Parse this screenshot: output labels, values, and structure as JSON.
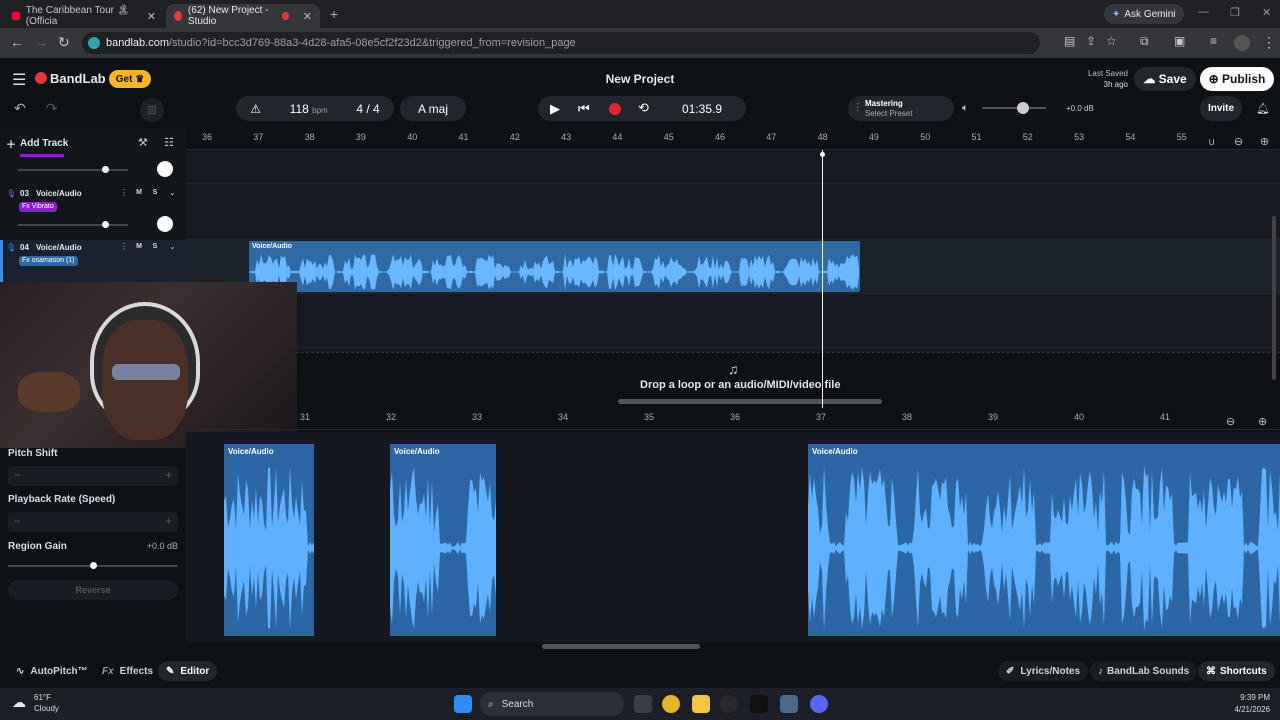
{
  "browser": {
    "tabs": [
      {
        "title": "The Caribbean Tour 🏝 (Officia"
      },
      {
        "title": "(62) New Project - Studio"
      }
    ],
    "url_host": "bandlab.com",
    "url_path": "/studio?id=bcc3d769-88a3-4d28-afa5-08e5cf2f23d2&triggered_from=revision_page",
    "ask_gemini": "Ask Gemini"
  },
  "app": {
    "logo": "BandLab",
    "get_label": "Get",
    "project_title": "New Project",
    "last_saved_label": "Last Saved",
    "last_saved_time": "3h ago",
    "save_label": "Save",
    "publish_label": "Publish",
    "invite_label": "Invite"
  },
  "transport": {
    "bpm": "118",
    "bpm_unit": "bpm",
    "time_sig": "4 / 4",
    "key": "A maj",
    "time": "01:35.9",
    "mastering_label": "Mastering",
    "mastering_preset": "Select Preset",
    "volume": "+0.0 dB"
  },
  "tracks": {
    "add_track": "Add Track",
    "list": [
      {
        "number": "03",
        "name": "Voice/Audio",
        "fx": "Fx  Vibrato",
        "m": "M",
        "s": "S"
      },
      {
        "number": "04",
        "name": "Voice/Audio",
        "fx": "Fx  osamason (1)",
        "m": "M",
        "s": "S"
      }
    ],
    "region_label": "Voice/Audio",
    "drop_text": "Drop a loop or an audio/MIDI/video file"
  },
  "ruler_top": [
    "36",
    "37",
    "38",
    "39",
    "40",
    "41",
    "42",
    "43",
    "44",
    "45",
    "46",
    "47",
    "48",
    "49",
    "50",
    "51",
    "52",
    "53",
    "54",
    "55"
  ],
  "ruler_bottom": [
    "31",
    "32",
    "33",
    "34",
    "35",
    "36",
    "37",
    "38",
    "39",
    "40",
    "41"
  ],
  "editor": {
    "pitch_shift": "Pitch Shift",
    "playback_rate": "Playback Rate (Speed)",
    "region_gain": "Region Gain",
    "region_gain_value": "+0.0 dB",
    "reverse": "Reverse",
    "minus": "−",
    "plus": "+",
    "region_label": "Voice/Audio"
  },
  "bottom": {
    "autopitch": "AutoPitch™",
    "effects": "Effects",
    "editor": "Editor",
    "lyrics": "Lyrics/Notes",
    "sounds": "BandLab Sounds",
    "shortcuts": "Shortcuts"
  },
  "taskbar": {
    "temp": "61°F",
    "weather": "Cloudy",
    "search": "Search",
    "time": "9:39 PM",
    "date": "4/21/2026"
  },
  "colors": {
    "accent": "#2f6aa5",
    "record": "#e3262e",
    "get": "#f5b625"
  }
}
